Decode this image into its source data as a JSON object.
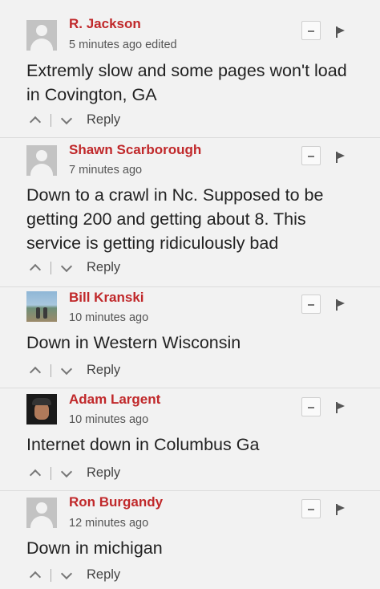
{
  "comments": [
    {
      "name": "R. Jackson",
      "meta": "5 minutes ago edited",
      "body": "Extremly slow and some pages won't load in Covington, GA",
      "avatar": "generic-avatar",
      "reply_label": "Reply"
    },
    {
      "name": "Shawn Scarborough",
      "meta": "7 minutes ago",
      "body": "Down to a crawl in Nc. Supposed to be getting 200 and getting about 8. This service is getting ridiculously bad",
      "avatar": "generic-avatar",
      "reply_label": "Reply"
    },
    {
      "name": "Bill Kranski",
      "meta": "10 minutes ago",
      "body": "Down in Western Wisconsin",
      "avatar": "photo-avatar",
      "reply_label": "Reply"
    },
    {
      "name": "Adam Largent",
      "meta": "10 minutes ago",
      "body": "Internet down in Columbus Ga",
      "avatar": "photo-avatar",
      "reply_label": "Reply"
    },
    {
      "name": "Ron Burgandy",
      "meta": "12 minutes ago",
      "body": "Down in michigan",
      "avatar": "generic-avatar",
      "reply_label": "Reply"
    }
  ],
  "colors": {
    "author": "#c0282a",
    "background": "#f2f2f2"
  }
}
